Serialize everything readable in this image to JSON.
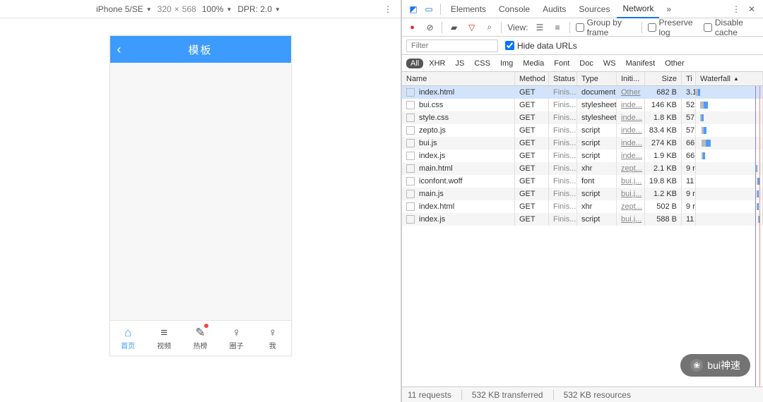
{
  "emulator": {
    "device": "iPhone 5/SE",
    "width": "320",
    "height": "568",
    "zoom": "100%",
    "dpr_label": "DPR: 2.0"
  },
  "app": {
    "header_title": "模板",
    "tabs": [
      {
        "label": "首页",
        "icon": "⌂",
        "active": true,
        "dot": false,
        "name": "tab-home"
      },
      {
        "label": "视频",
        "icon": "≡",
        "active": false,
        "dot": false,
        "name": "tab-video"
      },
      {
        "label": "热榜",
        "icon": "✎",
        "active": false,
        "dot": true,
        "name": "tab-hot"
      },
      {
        "label": "圈子",
        "icon": "♀",
        "active": false,
        "dot": false,
        "name": "tab-circle"
      },
      {
        "label": "我",
        "icon": "♀",
        "active": false,
        "dot": false,
        "name": "tab-me"
      }
    ]
  },
  "devtools": {
    "panel_tabs": [
      "Elements",
      "Console",
      "Audits",
      "Sources",
      "Network"
    ],
    "active_panel": "Network",
    "toolbar": {
      "view_label": "View:",
      "group_by_frame": "Group by frame",
      "preserve_log": "Preserve log",
      "disable_cache": "Disable cache"
    },
    "filter": {
      "placeholder": "Filter",
      "hide_data_urls": "Hide data URLs",
      "hide_checked": true
    },
    "type_filters": [
      "All",
      "XHR",
      "JS",
      "CSS",
      "Img",
      "Media",
      "Font",
      "Doc",
      "WS",
      "Manifest",
      "Other"
    ],
    "type_active": "All",
    "columns": {
      "name": "Name",
      "method": "Method",
      "status": "Status",
      "type": "Type",
      "initiator": "Initi...",
      "size": "Size",
      "time": "Ti",
      "waterfall": "Waterfall"
    },
    "rows": [
      {
        "name": "index.html",
        "method": "GET",
        "status": "Finis...",
        "type": "document",
        "initiator": "Other",
        "size": "682 B",
        "time": "3.1",
        "wf_a": 0,
        "wf_b": 6,
        "sel": true
      },
      {
        "name": "bui.css",
        "method": "GET",
        "status": "Finis...",
        "type": "stylesheet",
        "initiator": "inde...",
        "size": "146 KB",
        "time": "52",
        "wf_a": 6,
        "wf_b": 18
      },
      {
        "name": "style.css",
        "method": "GET",
        "status": "Finis...",
        "type": "stylesheet",
        "initiator": "inde...",
        "size": "1.8 KB",
        "time": "57",
        "wf_a": 6,
        "wf_b": 12
      },
      {
        "name": "zepto.js",
        "method": "GET",
        "status": "Finis...",
        "type": "script",
        "initiator": "inde...",
        "size": "83.4 KB",
        "time": "57",
        "wf_a": 8,
        "wf_b": 16
      },
      {
        "name": "bui.js",
        "method": "GET",
        "status": "Finis...",
        "type": "script",
        "initiator": "inde...",
        "size": "274 KB",
        "time": "66",
        "wf_a": 8,
        "wf_b": 22
      },
      {
        "name": "index.js",
        "method": "GET",
        "status": "Finis...",
        "type": "script",
        "initiator": "inde...",
        "size": "1.9 KB",
        "time": "66",
        "wf_a": 8,
        "wf_b": 14
      },
      {
        "name": "main.html",
        "method": "GET",
        "status": "Finis...",
        "type": "xhr",
        "initiator": "zept...",
        "size": "2.1 KB",
        "time": "9 r",
        "wf_a": 90,
        "wf_b": 92
      },
      {
        "name": "iconfont.woff",
        "method": "GET",
        "status": "Finis...",
        "type": "font",
        "initiator": "bui.j...",
        "size": "19.8 KB",
        "time": "11",
        "wf_a": 92,
        "wf_b": 95
      },
      {
        "name": "main.js",
        "method": "GET",
        "status": "Finis...",
        "type": "script",
        "initiator": "bui.j...",
        "size": "1.2 KB",
        "time": "9 r",
        "wf_a": 92,
        "wf_b": 94
      },
      {
        "name": "index.html",
        "method": "GET",
        "status": "Finis...",
        "type": "xhr",
        "initiator": "zept...",
        "size": "502 B",
        "time": "9 r",
        "wf_a": 92,
        "wf_b": 94
      },
      {
        "name": "index.js",
        "method": "GET",
        "status": "Finis...",
        "type": "script",
        "initiator": "bui.j...",
        "size": "588 B",
        "time": "11",
        "wf_a": 94,
        "wf_b": 96
      }
    ],
    "summary": {
      "requests": "11 requests",
      "transferred": "532 KB transferred",
      "resources": "532 KB resources"
    }
  },
  "watermark": "bui神速"
}
